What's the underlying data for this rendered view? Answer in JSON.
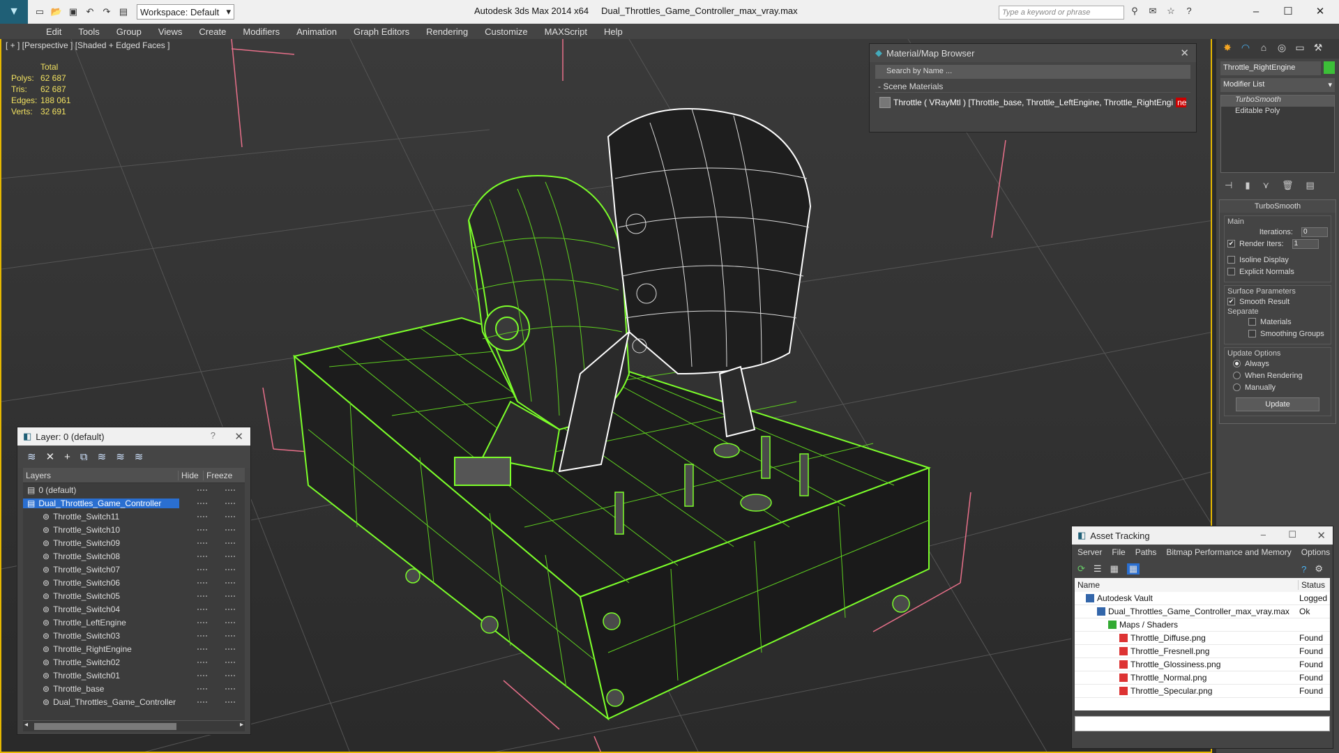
{
  "app": {
    "title": "Autodesk 3ds Max  2014 x64",
    "filename": "Dual_Throttles_Game_Controller_max_vray.max",
    "workspace": "Workspace: Default",
    "search_placeholder": "Type a keyword or phrase"
  },
  "menu": [
    "Edit",
    "Tools",
    "Group",
    "Views",
    "Create",
    "Modifiers",
    "Animation",
    "Graph Editors",
    "Rendering",
    "Customize",
    "MAXScript",
    "Help"
  ],
  "viewport": {
    "label": "[ + ] [Perspective ] [Shaded + Edged Faces ]",
    "stats": {
      "header": "Total",
      "polys_label": "Polys:",
      "polys": "62 687",
      "tris_label": "Tris:",
      "tris": "62 687",
      "edges_label": "Edges:",
      "edges": "188 061",
      "verts_label": "Verts:",
      "verts": "32 691"
    }
  },
  "layer_manager": {
    "title": "Layer: 0 (default)",
    "help": "?",
    "col_layers": "Layers",
    "col_hide": "Hide",
    "col_freeze": "Freeze",
    "rows": [
      {
        "name": "0 (default)",
        "indent": 0
      },
      {
        "name": "Dual_Throttles_Game_Controller",
        "indent": 0
      },
      {
        "name": "Throttle_Switch11",
        "indent": 1
      },
      {
        "name": "Throttle_Switch10",
        "indent": 1
      },
      {
        "name": "Throttle_Switch09",
        "indent": 1
      },
      {
        "name": "Throttle_Switch08",
        "indent": 1
      },
      {
        "name": "Throttle_Switch07",
        "indent": 1
      },
      {
        "name": "Throttle_Switch06",
        "indent": 1
      },
      {
        "name": "Throttle_Switch05",
        "indent": 1
      },
      {
        "name": "Throttle_Switch04",
        "indent": 1
      },
      {
        "name": "Throttle_LeftEngine",
        "indent": 1
      },
      {
        "name": "Throttle_Switch03",
        "indent": 1
      },
      {
        "name": "Throttle_RightEngine",
        "indent": 1
      },
      {
        "name": "Throttle_Switch02",
        "indent": 1
      },
      {
        "name": "Throttle_Switch01",
        "indent": 1
      },
      {
        "name": "Throttle_base",
        "indent": 1
      },
      {
        "name": "Dual_Throttles_Game_Controller",
        "indent": 1
      }
    ]
  },
  "material_browser": {
    "title": "Material/Map Browser",
    "search_placeholder": "Search by Name ...",
    "group": "- Scene Materials",
    "material_prefix": "Throttle  ( VRayMtl )  [Throttle_base, Throttle_LeftEngine, Throttle_RightEngi",
    "material_highlight": "ne..."
  },
  "command_panel": {
    "object_name": "Throttle_RightEngine",
    "modifier_list": "Modifier List",
    "stack": [
      "TurboSmooth",
      "Editable Poly"
    ],
    "rollout_title": "TurboSmooth",
    "main_label": "Main",
    "iterations_label": "Iterations:",
    "iterations": "0",
    "render_iters_label": "Render Iters:",
    "render_iters": "1",
    "isoline": "Isoline Display",
    "explicit": "Explicit Normals",
    "surface_label": "Surface Parameters",
    "smooth_result": "Smooth Result",
    "separate_label": "Separate",
    "materials": "Materials",
    "smoothing_groups": "Smoothing Groups",
    "update_label": "Update Options",
    "always": "Always",
    "when_rendering": "When Rendering",
    "manually": "Manually",
    "update_button": "Update"
  },
  "asset_tracking": {
    "title": "Asset Tracking",
    "menu": [
      "Server",
      "File",
      "Paths",
      "Bitmap Performance and Memory",
      "Options"
    ],
    "col_name": "Name",
    "col_status": "Status",
    "rows": [
      {
        "name": "Autodesk Vault",
        "status": "Logged",
        "indent": 1
      },
      {
        "name": "Dual_Throttles_Game_Controller_max_vray.max",
        "status": "Ok",
        "indent": 2
      },
      {
        "name": "Maps / Shaders",
        "status": "",
        "indent": 3
      },
      {
        "name": "Throttle_Diffuse.png",
        "status": "Found",
        "indent": 4
      },
      {
        "name": "Throttle_Fresnell.png",
        "status": "Found",
        "indent": 4
      },
      {
        "name": "Throttle_Glossiness.png",
        "status": "Found",
        "indent": 4
      },
      {
        "name": "Throttle_Normal.png",
        "status": "Found",
        "indent": 4
      },
      {
        "name": "Throttle_Specular.png",
        "status": "Found",
        "indent": 4
      }
    ]
  },
  "colors": {
    "wire": "#7cff2a",
    "selected_wire": "#ffffff",
    "selection": "#2a6fd1",
    "viewport_border": "#e6b800"
  }
}
